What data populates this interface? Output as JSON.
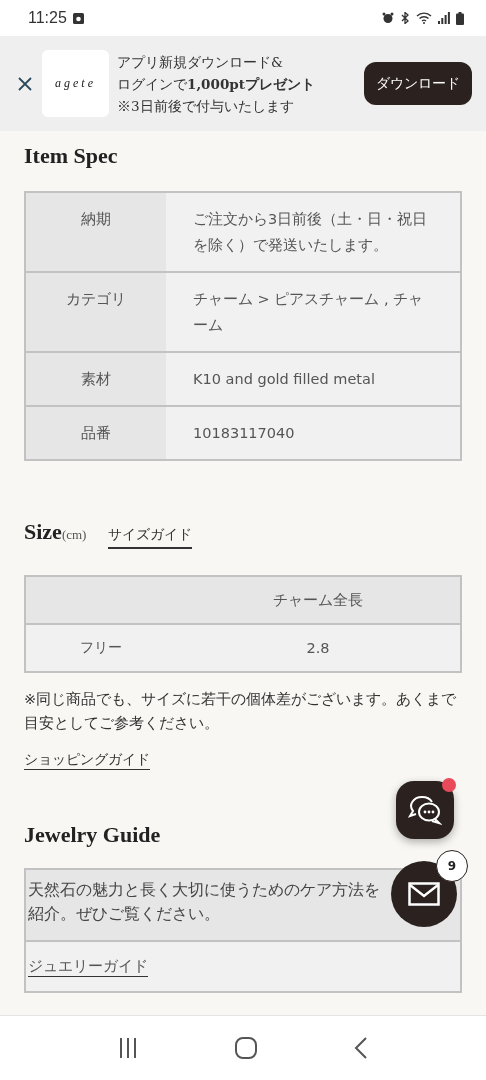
{
  "status_bar": {
    "time": "11:25"
  },
  "app_banner": {
    "logo": "agete",
    "lines": [
      "アプリ新規ダウンロード&",
      "ログインで**1,000ptプレゼント**",
      "※3日前後で付与いたします"
    ],
    "button": "ダウンロード"
  },
  "item_spec": {
    "title": "Item Spec",
    "rows": [
      {
        "label": "納期",
        "value": "ご注文から3日前後（土・日・祝日を除く）で発送いたします。"
      },
      {
        "label": "カテゴリ",
        "value": "チャーム > ピアスチャーム , チャーム"
      },
      {
        "label": "素材",
        "value": "K10 and gold filled metal"
      },
      {
        "label": "品番",
        "value": "10183117040"
      }
    ]
  },
  "size": {
    "title": "Size",
    "unit": "(cm)",
    "guide_link": "サイズガイド",
    "columns": [
      "チャーム全長"
    ],
    "rows": [
      {
        "label": "フリー",
        "values": [
          "2.8"
        ]
      }
    ],
    "note": "※同じ商品でも、サイズに若干の個体差がございます。あくまで目安としてご参考ください。",
    "shopping_link": "ショッピングガイド"
  },
  "jewelry_guide": {
    "title": "Jewelry Guide",
    "text": "天然石の魅力と長く大切に使うためのケア方法を紹介。ぜひご覧ください。",
    "link": "ジュエリーガイド"
  },
  "chat_button": {
    "unread": true
  },
  "mail_button": {
    "badge": "9"
  }
}
